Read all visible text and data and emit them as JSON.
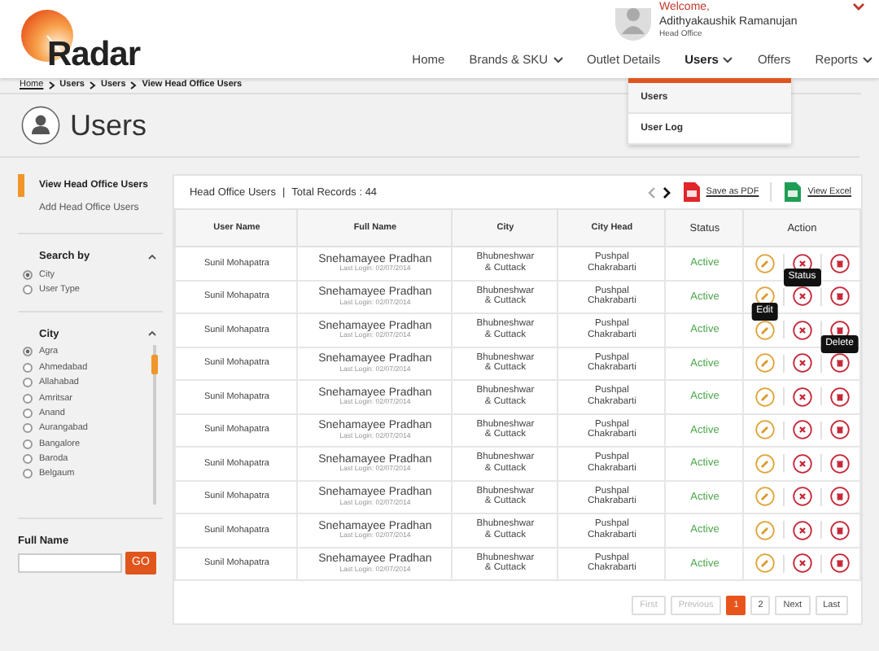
{
  "header": {
    "logo": "Radar",
    "welcome": "Welcome,",
    "user_name": "Adithyakaushik Ramanujan",
    "user_role": "Head Office"
  },
  "nav": [
    {
      "label": "Home",
      "dropdown": false,
      "selected": false
    },
    {
      "label": "Brands & SKU",
      "dropdown": true,
      "selected": false
    },
    {
      "label": "Outlet Details",
      "dropdown": false,
      "selected": false
    },
    {
      "label": "Users",
      "dropdown": true,
      "selected": true
    },
    {
      "label": "Offers",
      "dropdown": false,
      "selected": false
    },
    {
      "label": "Reports",
      "dropdown": true,
      "selected": false
    }
  ],
  "nav_menu": [
    {
      "label": "Users",
      "selected": true
    },
    {
      "label": "User Log",
      "selected": false
    }
  ],
  "breadcrumb": [
    "Home",
    "Users",
    "Users",
    "View Head Office Users"
  ],
  "page_title": "Users",
  "sidebar": {
    "links": [
      {
        "label": "View Head Office Users",
        "selected": true
      },
      {
        "label": "Add Head Office Users",
        "selected": false
      }
    ],
    "search_by": {
      "title": "Search by",
      "options": [
        {
          "label": "City",
          "selected": true
        },
        {
          "label": "User Type",
          "selected": false
        }
      ]
    },
    "city": {
      "title": "City",
      "options": [
        {
          "label": "Agra",
          "selected": true
        },
        {
          "label": "Ahmedabad",
          "selected": false
        },
        {
          "label": "Allahabad",
          "selected": false
        },
        {
          "label": "Amritsar",
          "selected": false
        },
        {
          "label": "Anand",
          "selected": false
        },
        {
          "label": "Aurangabad",
          "selected": false
        },
        {
          "label": "Bangalore",
          "selected": false
        },
        {
          "label": "Baroda",
          "selected": false
        },
        {
          "label": "Belgaum",
          "selected": false
        }
      ]
    },
    "full_name": {
      "label": "Full Name",
      "button": "GO"
    }
  },
  "table": {
    "title": "Head Office Users",
    "separator": "|",
    "total": "Total Records : 44",
    "save_pdf": "Save as PDF",
    "view_excel": "View Excel",
    "columns": [
      "User Name",
      "Full Name",
      "City",
      "City Head",
      "Status",
      "Action"
    ],
    "rows": [
      {
        "user": "Sunil Mohapatra",
        "full_name": "Snehamayee Pradhan",
        "last_login": "Last Login: 02/07/2014",
        "city": [
          "Bhubneshwar",
          "& Cuttack"
        ],
        "city_head": [
          "Pushpal",
          "Chakrabarti"
        ],
        "status": "Active"
      },
      {
        "user": "Sunil Mohapatra",
        "full_name": "Snehamayee Pradhan",
        "last_login": "Last Login: 02/07/2014",
        "city": [
          "Bhubneshwar",
          "& Cuttack"
        ],
        "city_head": [
          "Pushpal",
          "Chakrabarti"
        ],
        "status": "Active",
        "tooltip": {
          "kind": "status",
          "text": "Status"
        }
      },
      {
        "user": "Sunil Mohapatra",
        "full_name": "Snehamayee Pradhan",
        "last_login": "Last Login: 02/07/2014",
        "city": [
          "Bhubneshwar",
          "& Cuttack"
        ],
        "city_head": [
          "Pushpal",
          "Chakrabarti"
        ],
        "status": "Active",
        "tooltip": {
          "kind": "edit",
          "text": "Edit"
        }
      },
      {
        "user": "Sunil Mohapatra",
        "full_name": "Snehamayee Pradhan",
        "last_login": "Last Login: 02/07/2014",
        "city": [
          "Bhubneshwar",
          "& Cuttack"
        ],
        "city_head": [
          "Pushpal",
          "Chakrabarti"
        ],
        "status": "Active",
        "tooltip": {
          "kind": "delete",
          "text": "Delete"
        }
      },
      {
        "user": "Sunil Mohapatra",
        "full_name": "Snehamayee Pradhan",
        "last_login": "Last Login: 02/07/2014",
        "city": [
          "Bhubneshwar",
          "& Cuttack"
        ],
        "city_head": [
          "Pushpal",
          "Chakrabarti"
        ],
        "status": "Active"
      },
      {
        "user": "Sunil Mohapatra",
        "full_name": "Snehamayee Pradhan",
        "last_login": "Last Login: 02/07/2014",
        "city": [
          "Bhubneshwar",
          "& Cuttack"
        ],
        "city_head": [
          "Pushpal",
          "Chakrabarti"
        ],
        "status": "Active"
      },
      {
        "user": "Sunil Mohapatra",
        "full_name": "Snehamayee Pradhan",
        "last_login": "Last Login: 02/07/2014",
        "city": [
          "Bhubneshwar",
          "& Cuttack"
        ],
        "city_head": [
          "Pushpal",
          "Chakrabarti"
        ],
        "status": "Active"
      },
      {
        "user": "Sunil Mohapatra",
        "full_name": "Snehamayee Pradhan",
        "last_login": "Last Login: 02/07/2014",
        "city": [
          "Bhubneshwar",
          "& Cuttack"
        ],
        "city_head": [
          "Pushpal",
          "Chakrabarti"
        ],
        "status": "Active"
      },
      {
        "user": "Sunil Mohapatra",
        "full_name": "Snehamayee Pradhan",
        "last_login": "Last Login: 02/07/2014",
        "city": [
          "Bhubneshwar",
          "& Cuttack"
        ],
        "city_head": [
          "Pushpal",
          "Chakrabarti"
        ],
        "status": "Active"
      },
      {
        "user": "Sunil Mohapatra",
        "full_name": "Snehamayee Pradhan",
        "last_login": "Last Login: 02/07/2014",
        "city": [
          "Bhubneshwar",
          "& Cuttack"
        ],
        "city_head": [
          "Pushpal",
          "Chakrabarti"
        ],
        "status": "Active"
      }
    ],
    "pagination": [
      {
        "label": "First",
        "kind": "nav",
        "disabled": true,
        "selected": false
      },
      {
        "label": "Previous",
        "kind": "nav",
        "disabled": true,
        "selected": false
      },
      {
        "label": "1",
        "kind": "page",
        "disabled": false,
        "selected": true
      },
      {
        "label": "2",
        "kind": "page",
        "disabled": false,
        "selected": false
      },
      {
        "label": "Next",
        "kind": "nav",
        "disabled": false,
        "selected": false
      },
      {
        "label": "Last",
        "kind": "nav",
        "disabled": false,
        "selected": false
      }
    ]
  }
}
